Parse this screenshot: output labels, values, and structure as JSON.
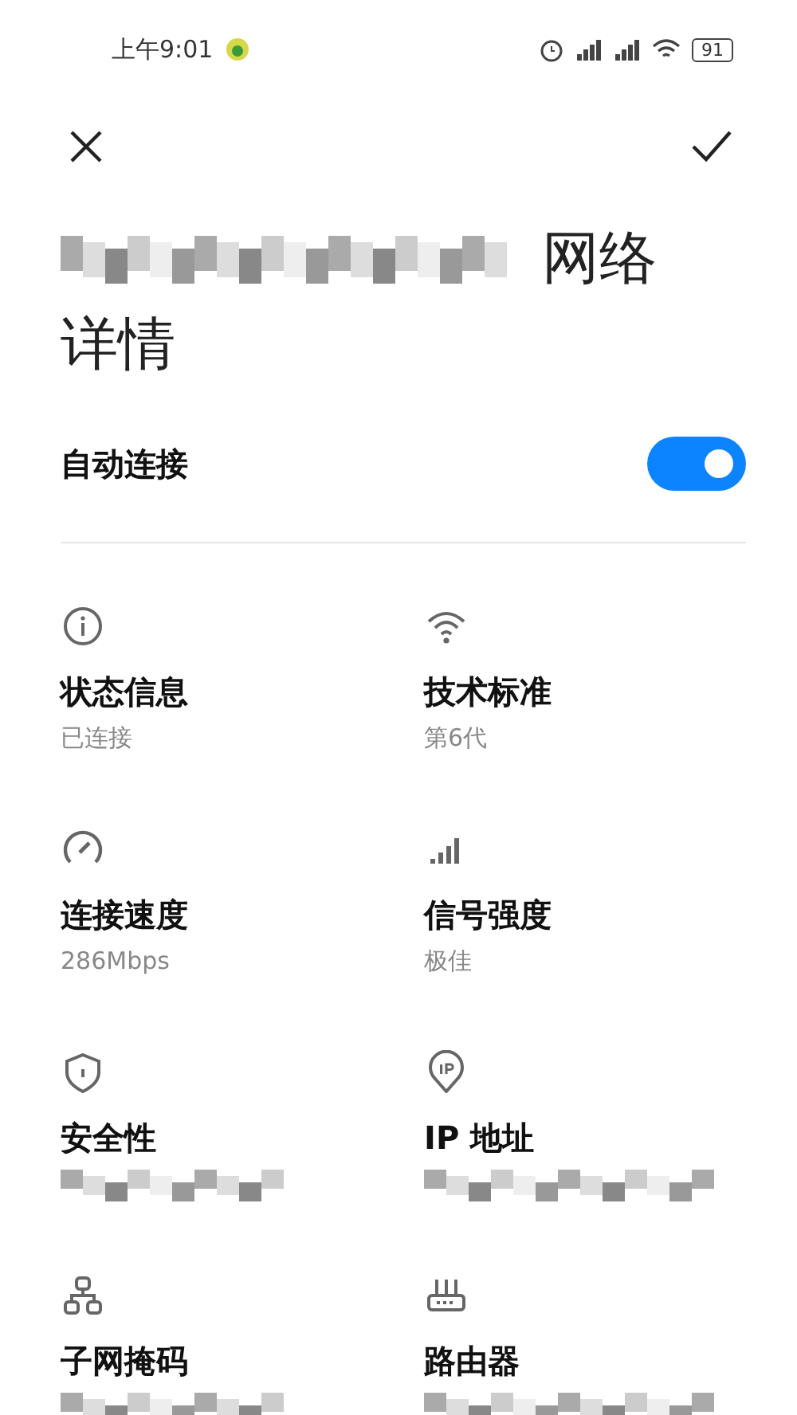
{
  "status_bar": {
    "time": "上午9:01",
    "battery": "91"
  },
  "title": {
    "lines": [
      "网络",
      "详情"
    ],
    "redacted_prefix": true
  },
  "auto_connect": {
    "label": "自动连接",
    "on": true
  },
  "details": [
    {
      "label": "状态信息",
      "value": "已连接",
      "redacted": false
    },
    {
      "label": "技术标准",
      "value": "第6代",
      "redacted": false
    },
    {
      "label": "连接速度",
      "value": "286Mbps",
      "redacted": false
    },
    {
      "label": "信号强度",
      "value": "极佳",
      "redacted": false
    },
    {
      "label": "安全性",
      "redacted": true
    },
    {
      "label": "IP 地址",
      "redacted": true
    },
    {
      "label": "子网掩码",
      "redacted": true
    },
    {
      "label": "路由器",
      "redacted": true
    }
  ]
}
